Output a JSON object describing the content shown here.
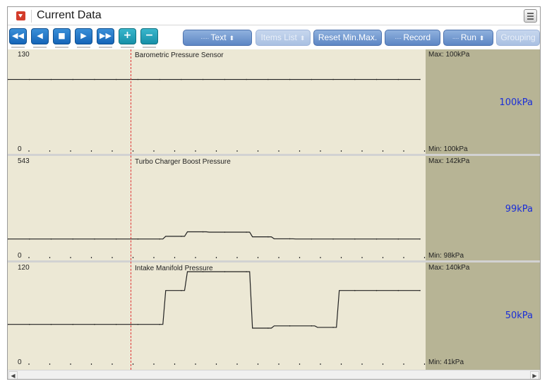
{
  "window": {
    "title": "Current Data",
    "title_icon": "dropdown-arrow-icon",
    "menu_icon": "window-menu-icon"
  },
  "toolbar": {
    "nav_buttons": [
      {
        "name": "rewind",
        "glyph": "◀◀",
        "icon": "rewind-icon"
      },
      {
        "name": "previous",
        "glyph": "◀",
        "icon": "previous-icon"
      },
      {
        "name": "stop",
        "glyph": "■",
        "icon": "stop-icon"
      },
      {
        "name": "play",
        "glyph": "▶",
        "icon": "play-icon"
      },
      {
        "name": "fast-forward",
        "glyph": "▶▶",
        "icon": "fast-forward-icon"
      },
      {
        "name": "add",
        "glyph": "+",
        "icon": "plus-icon"
      },
      {
        "name": "remove",
        "glyph": "−",
        "icon": "minus-icon"
      }
    ],
    "text_label": "Text",
    "items_list_label": "Items List",
    "reset_label": "Reset Min.Max.",
    "record_label": "Record",
    "run_label": "Run",
    "grouping_label": "Grouping"
  },
  "panels": [
    {
      "title": "Barometric Pressure Sensor",
      "ymax": "130",
      "ymin": "0",
      "max_text": "Max:  100kPa",
      "min_text": "Min:   100kPa",
      "current": "100kPa"
    },
    {
      "title": "Turbo Charger Boost Pressure",
      "ymax": "543",
      "ymin": "0",
      "max_text": "Max:  142kPa",
      "min_text": "Min:    98kPa",
      "current": "99kPa"
    },
    {
      "title": "Intake Manifold Pressure",
      "ymax": "120",
      "ymin": "0",
      "max_text": "Max:  140kPa",
      "min_text": "Min:    41kPa",
      "current": "50kPa"
    }
  ],
  "chart_data": [
    {
      "type": "line",
      "title": "Barometric Pressure Sensor",
      "ylim": [
        0,
        130
      ],
      "unit": "kPa",
      "x": [
        0,
        1,
        2,
        3,
        4,
        5,
        6,
        7,
        8,
        9,
        10,
        11,
        12,
        13,
        14,
        15,
        16,
        17,
        18,
        19
      ],
      "values": [
        100,
        100,
        100,
        100,
        100,
        100,
        100,
        100,
        100,
        100,
        100,
        100,
        100,
        100,
        100,
        100,
        100,
        100,
        100,
        100
      ]
    },
    {
      "type": "line",
      "title": "Turbo Charger Boost Pressure",
      "ylim": [
        0,
        543
      ],
      "unit": "kPa",
      "x": [
        0,
        1,
        2,
        3,
        4,
        5,
        6,
        7,
        8,
        9,
        10,
        11,
        12,
        13,
        14,
        15,
        16,
        17,
        18,
        19
      ],
      "values": [
        99,
        99,
        99,
        99,
        99,
        99,
        99,
        99,
        115,
        142,
        140,
        140,
        112,
        100,
        99,
        99,
        99,
        99,
        99,
        99
      ]
    },
    {
      "type": "line",
      "title": "Intake Manifold Pressure",
      "ylim": [
        0,
        120
      ],
      "unit": "kPa",
      "x": [
        0,
        1,
        2,
        3,
        4,
        5,
        6,
        7,
        8,
        9,
        10,
        11,
        12,
        13,
        14,
        15,
        16,
        17,
        18,
        19
      ],
      "values": [
        50,
        50,
        50,
        50,
        50,
        50,
        50,
        50,
        95,
        120,
        120,
        120,
        45,
        48,
        48,
        46,
        95,
        95,
        95,
        95
      ]
    }
  ],
  "colors": {
    "trace": "#222222",
    "current_value": "#1a2ed8",
    "cursor": "#e03030",
    "plot_bg": "#ece8d5",
    "side_bg": "#b7b495"
  }
}
